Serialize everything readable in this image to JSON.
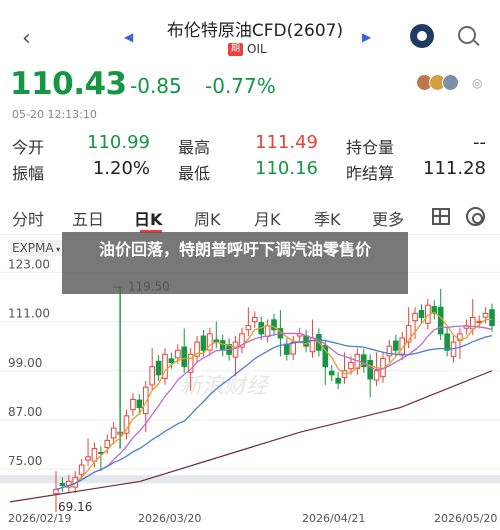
{
  "header": {
    "title": "布伦特原油CFD(2607)",
    "subtitle": "OIL",
    "badge": "期"
  },
  "quote": {
    "price": "110.43",
    "change": "-0.85",
    "change_pct": "-0.77%",
    "time": "05-20 12:13:10"
  },
  "stats": [
    {
      "label": "今开",
      "value": "110.99",
      "color": "#159642"
    },
    {
      "label": "最高",
      "value": "111.49",
      "color": "#e8433a"
    },
    {
      "label": "持仓量",
      "value": "--",
      "color": "#222222"
    },
    {
      "label": "振幅",
      "value": "1.20%",
      "color": "#222222"
    },
    {
      "label": "最低",
      "value": "110.16",
      "color": "#159642"
    },
    {
      "label": "昨结算",
      "value": "111.28",
      "color": "#222222"
    }
  ],
  "tabs": [
    "分时",
    "五日",
    "日K",
    "周K",
    "月K",
    "季K",
    "更多"
  ],
  "active_tab": "日K",
  "indicator": "EXPMA",
  "headline": "油价回落，特朗普呼吁下调汽油零售价",
  "watermark": "新浪财经",
  "colors": {
    "up": "#e8433a",
    "down": "#159642",
    "accent": "#3a66d6"
  },
  "chart_data": {
    "type": "candlestick",
    "y_ticks": [
      "123.00",
      "111.00",
      "99.00",
      "87.00",
      "75.00"
    ],
    "x_ticks": [
      "2026/02/19",
      "2026/03/20",
      "2026/04/21",
      "2026/05/20"
    ],
    "max_label": "119.50",
    "min_label": "69.16",
    "ylim": [
      66,
      127
    ]
  }
}
